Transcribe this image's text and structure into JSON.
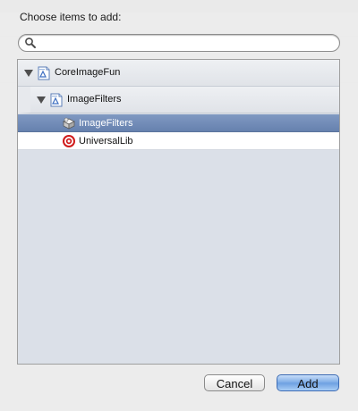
{
  "dialog": {
    "title": "Choose items to add:",
    "search": {
      "value": "",
      "placeholder": ""
    },
    "tree": [
      {
        "label": "CoreImageFun",
        "icon": "project-icon",
        "expanded": true
      },
      {
        "label": "ImageFilters",
        "icon": "project-icon",
        "expanded": true
      },
      {
        "label": "ImageFilters",
        "icon": "static-library-target-icon",
        "selected": true
      },
      {
        "label": "UniversalLib",
        "icon": "aggregate-target-icon",
        "selected": false
      }
    ],
    "buttons": {
      "cancel": "Cancel",
      "add": "Add"
    }
  },
  "colors": {
    "selection": "#6f89b5",
    "tree_background": "#dbe0e8",
    "default_button": "#7aa9e6"
  }
}
